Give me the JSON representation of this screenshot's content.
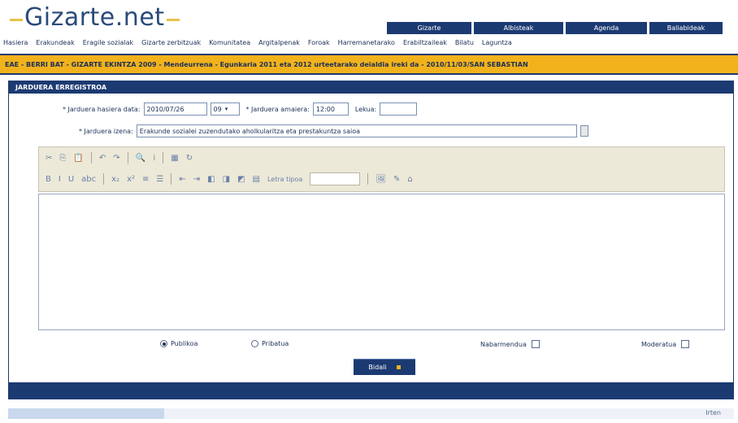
{
  "logo": {
    "text": "Gizarte.net"
  },
  "topnav": [
    {
      "label": "Gizarte"
    },
    {
      "label": "Albisteak"
    },
    {
      "label": "Agenda"
    },
    {
      "label": "Baliabideak"
    }
  ],
  "links": [
    "Hasiera",
    "Erakundeak",
    "Eragile sozialak",
    "Gizarte zerbitzuak",
    "Komunitatea",
    "Argitalpenak",
    "Foroak",
    "Harremanetarako",
    "Erabiltzaileak",
    "Bilatu",
    "Laguntza"
  ],
  "newsbar": {
    "text": "EAE - BERRI BAT - GIZARTE EKINTZA 2009 - Mendeurrena - Egunkaria 2011 eta 2012 urteetarako deialdia ireki da - 2010/11/03/SAN SEBASTIAN"
  },
  "panel": {
    "title": "JARDUERA ERREGISTROA"
  },
  "form": {
    "date_label": "* Jarduera hasiera data:",
    "date_value": "2010/07/26",
    "hour_value": "09",
    "finish_label": "* Jarduera amaiera:",
    "finish_value": "12:00",
    "location_label": "Lekua:",
    "location_value": "",
    "desc_label": "* Jarduera izena:",
    "desc_value": "Erakunde sozialei zuzendutako aholkularitza eta prestakuntza saioa"
  },
  "toolbar": {
    "row1": [
      "✂",
      "⎘",
      "📋",
      "↶",
      "↷",
      "🔍",
      "⁞",
      "▦",
      "↻"
    ],
    "row2": [
      "B",
      "I",
      "U",
      "abc",
      "x₂",
      "x²",
      "≡",
      "☰",
      "⇤",
      "⇥",
      "◧",
      "◨",
      "◩",
      "▤"
    ],
    "font_label": "Letra tipoa",
    "row2_end": [
      "🖼",
      "✎",
      "⌂"
    ]
  },
  "options": {
    "radio_public": "Publikoa",
    "radio_private": "Pribatua",
    "public_selected": true,
    "check_featured": "Nabarmendua",
    "check_moderated": "Moderatua"
  },
  "send_button": {
    "label": "Bidali"
  },
  "footer": {
    "right_text": "Irten"
  }
}
